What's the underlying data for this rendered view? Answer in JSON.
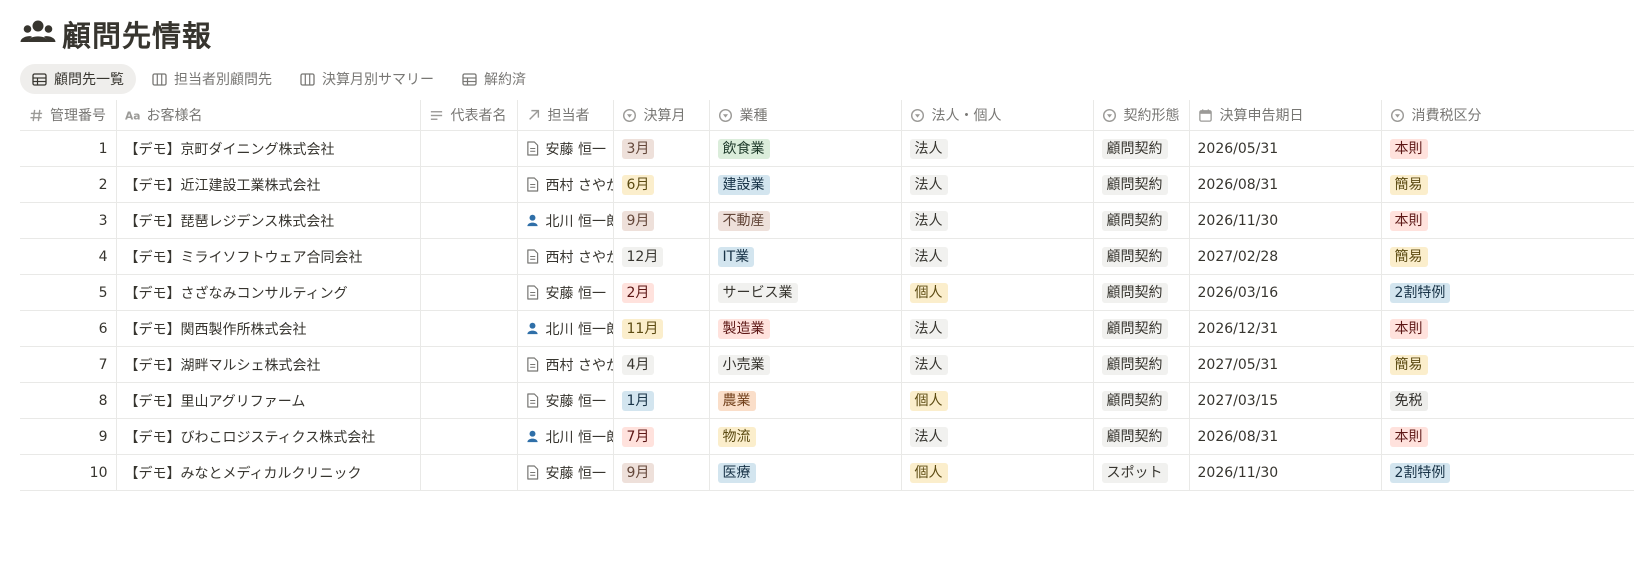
{
  "page": {
    "title": "顧問先情報",
    "icon": "people-icon"
  },
  "tabs": [
    {
      "label": "顧問先一覧",
      "icon": "table-icon",
      "active": true
    },
    {
      "label": "担当者別顧問先",
      "icon": "board-icon",
      "active": false
    },
    {
      "label": "決算月別サマリー",
      "icon": "board-icon",
      "active": false
    },
    {
      "label": "解約済",
      "icon": "table-icon",
      "active": false
    }
  ],
  "columns": [
    {
      "label": "管理番号",
      "icon": "hash-icon"
    },
    {
      "label": "お客様名",
      "icon": "text-aa-icon"
    },
    {
      "label": "代表者名",
      "icon": "lines-icon"
    },
    {
      "label": "担当者",
      "icon": "relation-arrow-icon"
    },
    {
      "label": "決算月",
      "icon": "select-icon"
    },
    {
      "label": "業種",
      "icon": "select-icon"
    },
    {
      "label": "法人・個人",
      "icon": "select-icon"
    },
    {
      "label": "契約形態",
      "icon": "select-icon"
    },
    {
      "label": "決算申告期日",
      "icon": "calendar-icon"
    },
    {
      "label": "消費税区分",
      "icon": "select-icon"
    }
  ],
  "colors": {
    "brown": "#eee0da",
    "orange": "#fadec9",
    "yellow": "#fbeecc",
    "green": "#dbeddb",
    "blue": "#d3e5ef",
    "red": "#ffe2dd",
    "gray": "#ededeb",
    "default": "#f1f1ef"
  },
  "rows": [
    {
      "no": "1",
      "name": "【デモ】京町ダイニング株式会社",
      "rep": "",
      "staff": "安藤 恒一",
      "staff_icon": "page-icon",
      "month": "3月",
      "month_color": "brown",
      "industry": "飲食業",
      "industry_color": "green",
      "type": "法人",
      "type_color": "default",
      "contract": "顧問契約",
      "contract_color": "default",
      "due": "2026/05/31",
      "tax": "本則",
      "tax_color": "red"
    },
    {
      "no": "2",
      "name": "【デモ】近江建設工業株式会社",
      "rep": "",
      "staff": "西村 さやか",
      "staff_icon": "page-icon",
      "month": "6月",
      "month_color": "yellow",
      "industry": "建設業",
      "industry_color": "blue",
      "type": "法人",
      "type_color": "default",
      "contract": "顧問契約",
      "contract_color": "default",
      "due": "2026/08/31",
      "tax": "簡易",
      "tax_color": "yellow"
    },
    {
      "no": "3",
      "name": "【デモ】琵琶レジデンス株式会社",
      "rep": "",
      "staff": "北川 恒一郎",
      "staff_icon": "person-icon",
      "month": "9月",
      "month_color": "brown",
      "industry": "不動産",
      "industry_color": "brown",
      "type": "法人",
      "type_color": "default",
      "contract": "顧問契約",
      "contract_color": "default",
      "due": "2026/11/30",
      "tax": "本則",
      "tax_color": "red"
    },
    {
      "no": "4",
      "name": "【デモ】ミライソフトウェア合同会社",
      "rep": "",
      "staff": "西村 さやか",
      "staff_icon": "page-icon",
      "month": "12月",
      "month_color": "default",
      "industry": "IT業",
      "industry_color": "blue",
      "type": "法人",
      "type_color": "default",
      "contract": "顧問契約",
      "contract_color": "default",
      "due": "2027/02/28",
      "tax": "簡易",
      "tax_color": "yellow"
    },
    {
      "no": "5",
      "name": "【デモ】さざなみコンサルティング",
      "rep": "",
      "staff": "安藤 恒一",
      "staff_icon": "page-icon",
      "month": "2月",
      "month_color": "red",
      "industry": "サービス業",
      "industry_color": "default",
      "type": "個人",
      "type_color": "yellow",
      "contract": "顧問契約",
      "contract_color": "default",
      "due": "2026/03/16",
      "tax": "2割特例",
      "tax_color": "blue"
    },
    {
      "no": "6",
      "name": "【デモ】関西製作所株式会社",
      "rep": "",
      "staff": "北川 恒一郎",
      "staff_icon": "person-icon",
      "month": "11月",
      "month_color": "yellow",
      "industry": "製造業",
      "industry_color": "red",
      "type": "法人",
      "type_color": "default",
      "contract": "顧問契約",
      "contract_color": "default",
      "due": "2026/12/31",
      "tax": "本則",
      "tax_color": "red"
    },
    {
      "no": "7",
      "name": "【デモ】湖畔マルシェ株式会社",
      "rep": "",
      "staff": "西村 さやか",
      "staff_icon": "page-icon",
      "month": "4月",
      "month_color": "default",
      "industry": "小売業",
      "industry_color": "default",
      "type": "法人",
      "type_color": "default",
      "contract": "顧問契約",
      "contract_color": "default",
      "due": "2027/05/31",
      "tax": "簡易",
      "tax_color": "yellow"
    },
    {
      "no": "8",
      "name": "【デモ】里山アグリファーム",
      "rep": "",
      "staff": "安藤 恒一",
      "staff_icon": "page-icon",
      "month": "1月",
      "month_color": "blue",
      "industry": "農業",
      "industry_color": "orange",
      "type": "個人",
      "type_color": "yellow",
      "contract": "顧問契約",
      "contract_color": "default",
      "due": "2027/03/15",
      "tax": "免税",
      "tax_color": "gray"
    },
    {
      "no": "9",
      "name": "【デモ】びわこロジスティクス株式会社",
      "rep": "",
      "staff": "北川 恒一郎",
      "staff_icon": "person-icon",
      "month": "7月",
      "month_color": "red",
      "industry": "物流",
      "industry_color": "yellow",
      "type": "法人",
      "type_color": "default",
      "contract": "顧問契約",
      "contract_color": "default",
      "due": "2026/08/31",
      "tax": "本則",
      "tax_color": "red"
    },
    {
      "no": "10",
      "name": "【デモ】みなとメディカルクリニック",
      "rep": "",
      "staff": "安藤 恒一",
      "staff_icon": "page-icon",
      "month": "9月",
      "month_color": "brown",
      "industry": "医療",
      "industry_color": "blue",
      "type": "個人",
      "type_color": "yellow",
      "contract": "スポット",
      "contract_color": "default",
      "due": "2026/11/30",
      "tax": "2割特例",
      "tax_color": "blue"
    }
  ]
}
